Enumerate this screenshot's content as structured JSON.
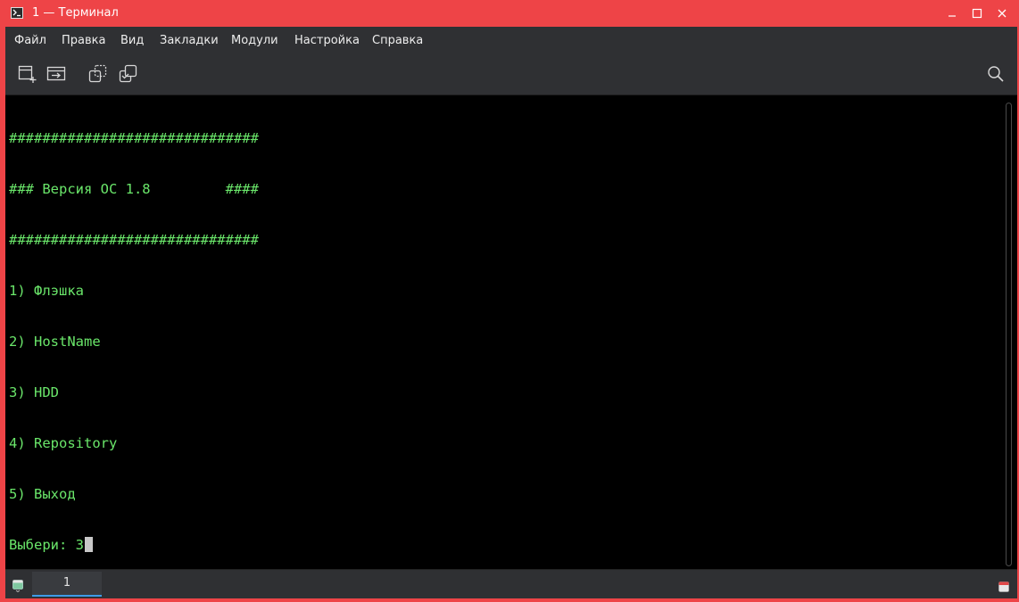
{
  "window": {
    "title": "1 — Терминал",
    "accent_color": "#ee4447",
    "controls": [
      "minimize-icon",
      "maximize-icon",
      "close-icon"
    ]
  },
  "menubar": {
    "items": [
      "Файл",
      "Правка",
      "Вид",
      "Закладки",
      "Модули",
      "Настройка",
      "Справка"
    ]
  },
  "toolbar": {
    "buttons": [
      "new-tab-icon",
      "new-window-icon",
      "split-copy-icon",
      "split-view-icon"
    ],
    "search_icon": "search-icon"
  },
  "terminal": {
    "text_color": "#6ae66a",
    "background": "#000000",
    "lines": [
      "##############################",
      "### Версия ОС 1.8         ####",
      "##############################",
      "1) Флэшка",
      "2) HostName",
      "3) HDD",
      "4) Repository",
      "5) Выход"
    ],
    "prompt": "Выбери: ",
    "input": "3"
  },
  "tabs": {
    "items": [
      {
        "label": "1",
        "active": true
      }
    ],
    "active_color": "#3d9be8"
  }
}
